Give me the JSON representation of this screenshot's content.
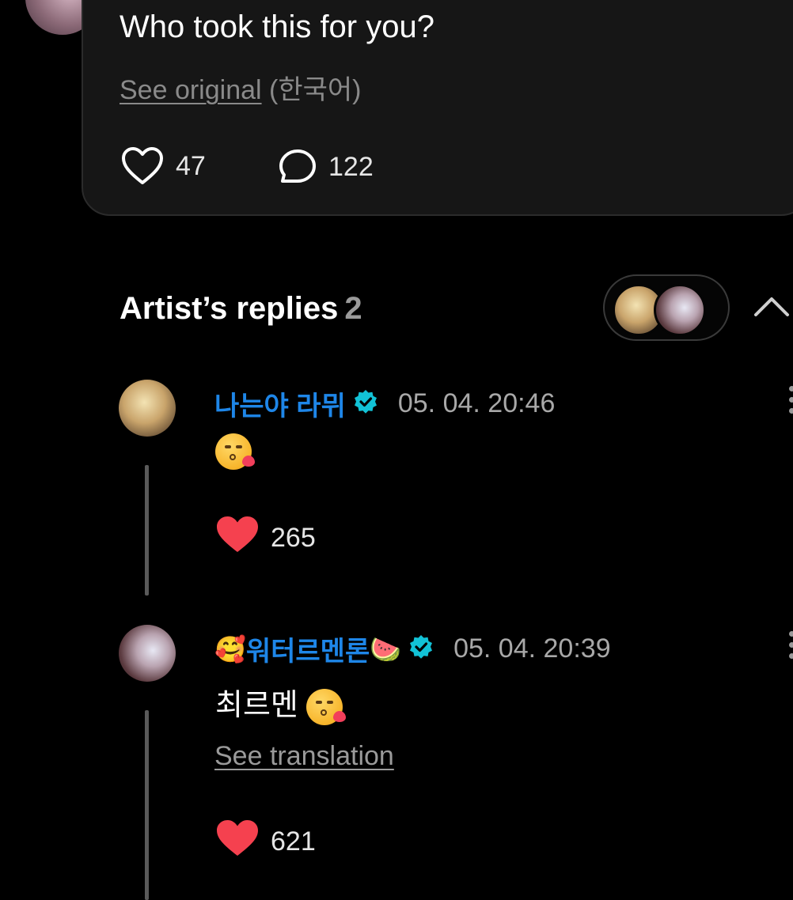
{
  "post": {
    "text": "Who took this for you?",
    "see_original_link": "See original",
    "original_language": "(한국어)",
    "like_count": "47",
    "comment_count": "122"
  },
  "artist_replies": {
    "title": "Artist’s replies",
    "count": "2"
  },
  "replies": [
    {
      "name": "나는야 라뮈",
      "time": "05. 04. 20:46",
      "body_text": "",
      "body_emoji": "😘",
      "like_count": "265",
      "see_translation": ""
    },
    {
      "name_prefix_emoji": "🥰",
      "name": "워터르멘론",
      "name_suffix_emoji": "🍉",
      "time": "05. 04. 20:39",
      "body_text": "최르멘",
      "body_emoji": "😘",
      "like_count": "621",
      "see_translation": "See translation"
    }
  ],
  "colors": {
    "background": "#000000",
    "card": "#161616",
    "name_blue": "#1e86e8",
    "verified": "#12c2d6",
    "heart": "#f5414f"
  },
  "icons": [
    "heart-outline-icon",
    "comment-bubble-icon",
    "chevron-up-icon",
    "verified-badge-icon",
    "heart-filled-icon",
    "more-vertical-icon"
  ]
}
